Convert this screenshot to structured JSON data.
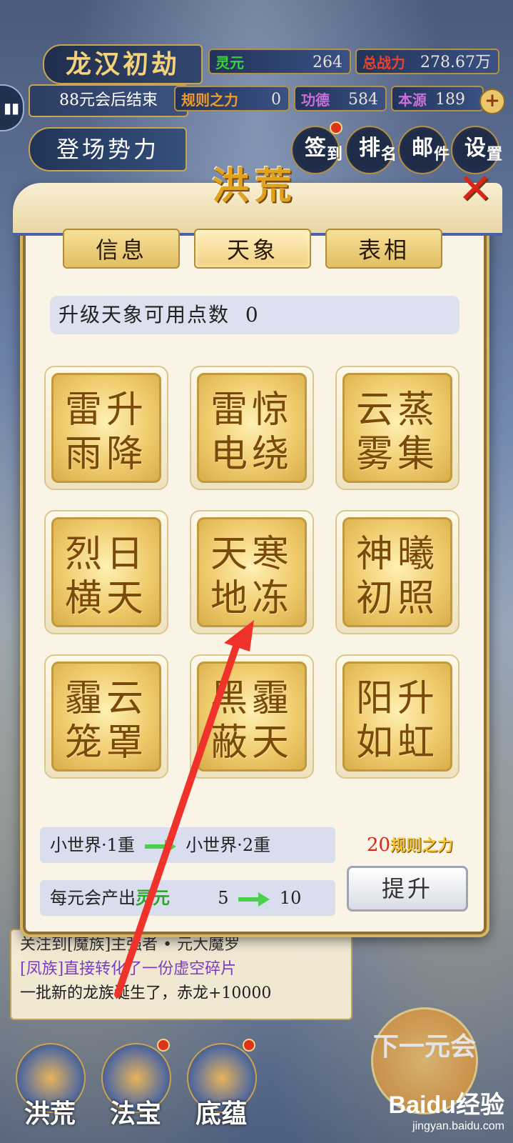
{
  "hud": {
    "era_title": "龙汉初劫",
    "era_subtitle": "88元会后结束",
    "faction_button": "登场势力",
    "stats": [
      {
        "label": "灵元",
        "value": "264",
        "color": "#3ad23a"
      },
      {
        "label": "总战力",
        "value": "278.67万",
        "color": "#e8432c"
      },
      {
        "label": "规则之力",
        "value": "0",
        "color": "#f19a2a"
      },
      {
        "label": "功德",
        "value": "584",
        "color": "#c870d8"
      },
      {
        "label": "本源",
        "value": "189",
        "color": "#c870d8"
      }
    ],
    "top_buttons": [
      {
        "main": "签",
        "small": "到"
      },
      {
        "main": "排",
        "small": "名"
      },
      {
        "main": "邮",
        "small": "件"
      },
      {
        "main": "设",
        "small": "置"
      }
    ]
  },
  "modal": {
    "title": "洪荒",
    "close_icon": "close-icon",
    "tabs": [
      "信息",
      "天象",
      "表相"
    ],
    "active_tab": 1,
    "points_label": "升级天象可用点数",
    "points_value": "0",
    "skills": [
      {
        "line1": "雷升",
        "line2": "雨降"
      },
      {
        "line1": "雷惊",
        "line2": "电绕"
      },
      {
        "line1": "云蒸",
        "line2": "雾集"
      },
      {
        "line1": "烈日",
        "line2": "横天"
      },
      {
        "line1": "天寒",
        "line2": "地冻"
      },
      {
        "line1": "神曦",
        "line2": "初照"
      },
      {
        "line1": "霾云",
        "line2": "笼罩"
      },
      {
        "line1": "黑霾",
        "line2": "蔽天"
      },
      {
        "line1": "阳升",
        "line2": "如虹"
      }
    ],
    "upgrade": {
      "from_world": "小世界·1重",
      "to_world": "小世界·2重",
      "produce_label": "每元会产出",
      "produce_resource": "灵元",
      "produce_from": "5",
      "produce_to": "10",
      "cost_value": "20",
      "cost_label": "规则之力",
      "raise_button": "提升"
    }
  },
  "log": {
    "line1": "关注到[魔族]主强者 • 元大魔罗",
    "line2": "[凤族]直接转化了一份虚空碎片",
    "line3": "一批新的龙族诞生了，赤龙+10000"
  },
  "bottom_nav": [
    "洪荒",
    "法宝",
    "底蕴"
  ],
  "next_button": "下一元会",
  "watermark": {
    "brand": "Baidu经验",
    "url": "jingyan.baidu.com"
  }
}
